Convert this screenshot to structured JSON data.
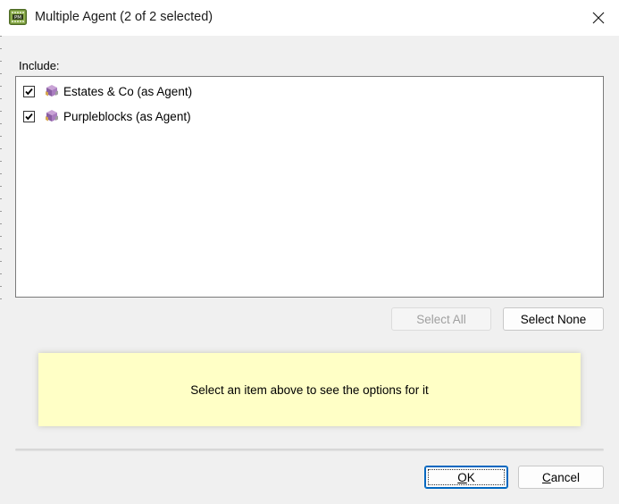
{
  "window": {
    "title": "Multiple Agent (2 of 2 selected)",
    "app_icon": "pm-app-icon",
    "close_icon": "close-icon"
  },
  "include": {
    "label": "Include:",
    "items": [
      {
        "label": "Estates & Co (as Agent)",
        "checked": true,
        "icon": "agent-cube-icon"
      },
      {
        "label": "Purpleblocks (as Agent)",
        "checked": true,
        "icon": "agent-cube-icon"
      }
    ]
  },
  "buttons": {
    "select_all": "Select All",
    "select_none": "Select None",
    "ok_mnemonic": "O",
    "ok_rest": "K",
    "cancel_mnemonic": "C",
    "cancel_rest": "ancel"
  },
  "info_panel": {
    "text": "Select an item above to see the options for it"
  },
  "colors": {
    "info_background": "#ffffc6",
    "accent": "#0067c0"
  }
}
